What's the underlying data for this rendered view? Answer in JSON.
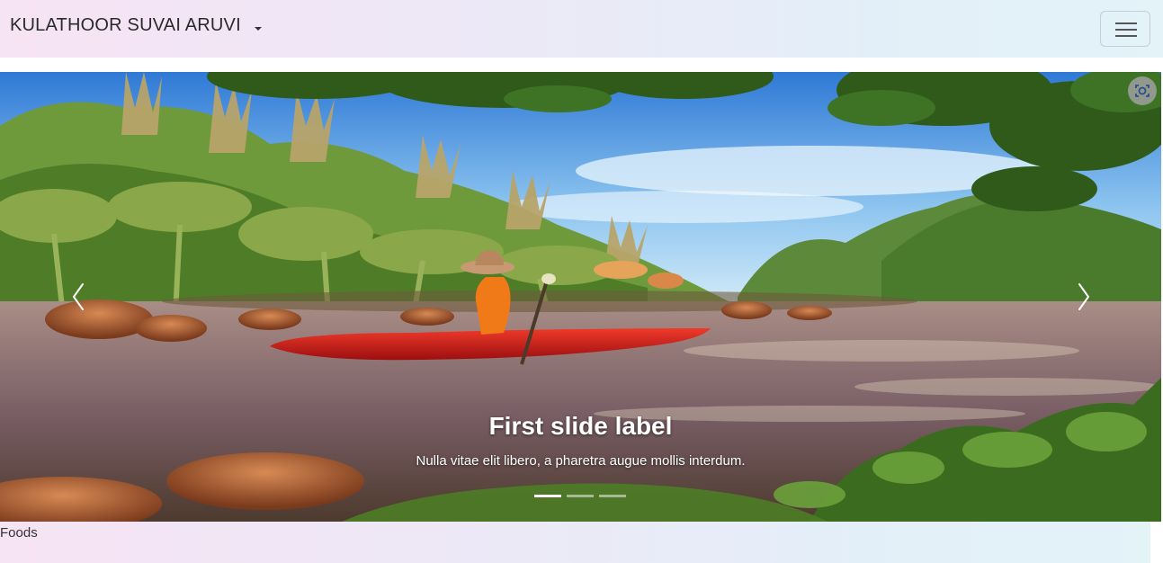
{
  "navbar": {
    "brand": "KULATHOOR SUVAI ARUVI",
    "dropdown_icon": "caret-down-icon",
    "toggler_icon": "hamburger-menu-icon"
  },
  "carousel": {
    "slide": {
      "title": "First slide label",
      "text": "Nulla vitae elit libero, a pharetra augue mollis interdum."
    },
    "prev_icon": "chevron-left-icon",
    "next_icon": "chevron-right-icon",
    "indicator_count": 3,
    "active_indicator": 1,
    "lens_icon": "image-search-icon"
  },
  "section": {
    "label": "Foods"
  },
  "colors": {
    "accent_text": "#2a2a2a",
    "gradient_start": "#f6e3f4",
    "gradient_end": "#e3f3f8"
  }
}
